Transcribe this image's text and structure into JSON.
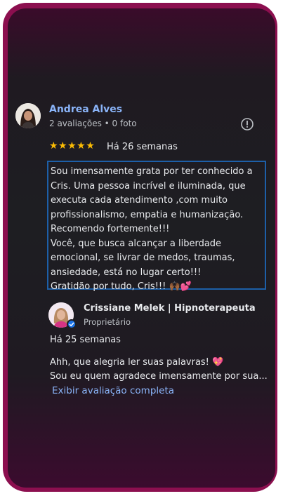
{
  "review": {
    "reviewer_name": "Andrea Alves",
    "reviewer_meta": "2 avaliações • 0 foto",
    "stars": "★★★★★",
    "rating": 5,
    "time_ago": "Há 26 semanas",
    "text": "Sou imensamente grata por ter conhecido a Cris. Uma pessoa incrível e iluminada, que executa cada atendimento ,com muito profissionalismo, empatia e humanização.\nRecomendo fortemente!!!\nVocê, que busca alcançar a liberdade emocional, se livrar de medos, traumas, ansiedade, está no lugar certo!!!\nGratidão por tudo, Cris!!! 🙌🏾💕",
    "flag_icon": "report-flag-icon"
  },
  "owner_reply": {
    "owner_name": "Crissiane Melek | Hipnoterapeuta",
    "owner_role": "Proprietário",
    "time_ago": "Há 25 semanas",
    "text": "Ahh, que alegria ler suas palavras! 💖\nSou eu quem agradece imensamente por sua...",
    "more_label": "Exibir avaliação completa"
  },
  "colors": {
    "frame": "#8c0f4f",
    "link": "#8ab4f8",
    "star": "#fbbc04",
    "highlight_border": "#1d5fa8"
  }
}
